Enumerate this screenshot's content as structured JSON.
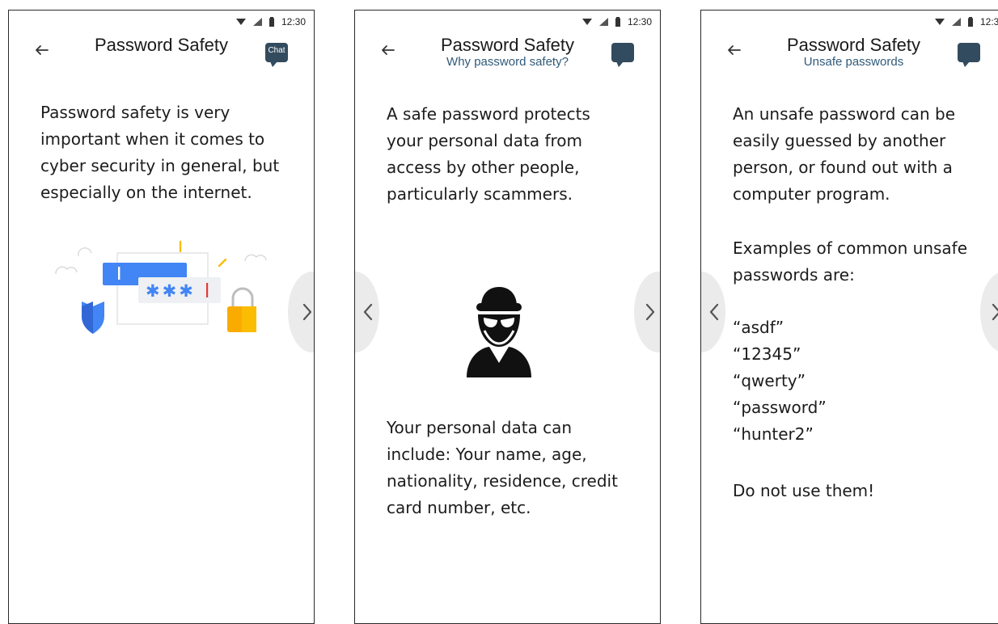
{
  "status_bar": {
    "time": "12:30"
  },
  "screens": [
    {
      "title": "Password Safety",
      "subtitle": "",
      "chat_label": "Chat",
      "paragraphs": [
        "Password safety is very\nimportant when it comes to\ncyber security in general, but\nespecially on the internet."
      ],
      "illustration": {
        "masked_password": "✱✱✱"
      },
      "nav": {
        "prev": false,
        "next": true
      }
    },
    {
      "title": "Password Safety",
      "subtitle": "Why password safety?",
      "chat_label": "",
      "paragraphs": [
        "A safe password protects\nyour personal data from\naccess by other people,\nparticularly scammers.",
        "Your personal data can\ninclude: Your name, age,\nnationality, residence, credit\ncard number, etc."
      ],
      "nav": {
        "prev": true,
        "next": true
      }
    },
    {
      "title": "Password Safety",
      "subtitle": "Unsafe passwords",
      "chat_label": "",
      "paragraphs": [
        "An unsafe password can be\neasily guessed by another\nperson, or found out with a\ncomputer program.",
        "Examples of common unsafe\npasswords are:",
        "“asdf”\n“12345”\n“qwerty”\n“password”\n“hunter2”",
        "Do not use them!"
      ],
      "nav": {
        "prev": true,
        "next": true
      }
    }
  ],
  "colors": {
    "chat_bubble": "#334b5e",
    "subtitle": "#2f5a78",
    "accent_blue": "#4285f4",
    "accent_yellow": "#fbbc04"
  },
  "icons": {
    "back": "arrow-left-icon",
    "chat": "chat-bubble-icon",
    "prev": "chevron-left-icon",
    "next": "chevron-right-icon"
  }
}
